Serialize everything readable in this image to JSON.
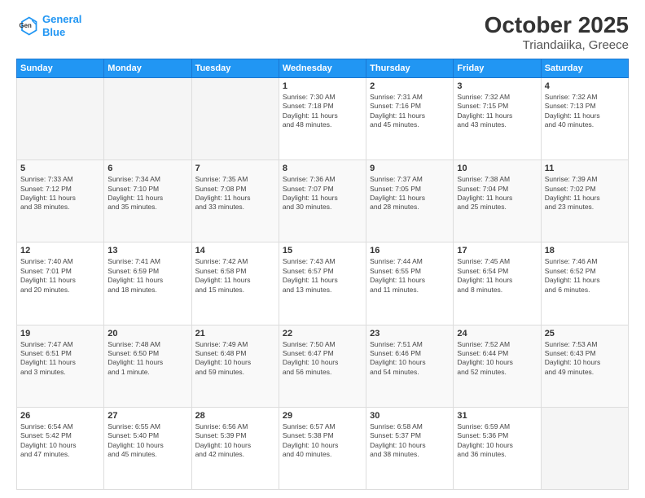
{
  "logo": {
    "line1": "General",
    "line2": "Blue"
  },
  "title": "October 2025",
  "subtitle": "Triandaiika, Greece",
  "days_of_week": [
    "Sunday",
    "Monday",
    "Tuesday",
    "Wednesday",
    "Thursday",
    "Friday",
    "Saturday"
  ],
  "weeks": [
    [
      {
        "day": "",
        "info": ""
      },
      {
        "day": "",
        "info": ""
      },
      {
        "day": "",
        "info": ""
      },
      {
        "day": "1",
        "info": "Sunrise: 7:30 AM\nSunset: 7:18 PM\nDaylight: 11 hours\nand 48 minutes."
      },
      {
        "day": "2",
        "info": "Sunrise: 7:31 AM\nSunset: 7:16 PM\nDaylight: 11 hours\nand 45 minutes."
      },
      {
        "day": "3",
        "info": "Sunrise: 7:32 AM\nSunset: 7:15 PM\nDaylight: 11 hours\nand 43 minutes."
      },
      {
        "day": "4",
        "info": "Sunrise: 7:32 AM\nSunset: 7:13 PM\nDaylight: 11 hours\nand 40 minutes."
      }
    ],
    [
      {
        "day": "5",
        "info": "Sunrise: 7:33 AM\nSunset: 7:12 PM\nDaylight: 11 hours\nand 38 minutes."
      },
      {
        "day": "6",
        "info": "Sunrise: 7:34 AM\nSunset: 7:10 PM\nDaylight: 11 hours\nand 35 minutes."
      },
      {
        "day": "7",
        "info": "Sunrise: 7:35 AM\nSunset: 7:08 PM\nDaylight: 11 hours\nand 33 minutes."
      },
      {
        "day": "8",
        "info": "Sunrise: 7:36 AM\nSunset: 7:07 PM\nDaylight: 11 hours\nand 30 minutes."
      },
      {
        "day": "9",
        "info": "Sunrise: 7:37 AM\nSunset: 7:05 PM\nDaylight: 11 hours\nand 28 minutes."
      },
      {
        "day": "10",
        "info": "Sunrise: 7:38 AM\nSunset: 7:04 PM\nDaylight: 11 hours\nand 25 minutes."
      },
      {
        "day": "11",
        "info": "Sunrise: 7:39 AM\nSunset: 7:02 PM\nDaylight: 11 hours\nand 23 minutes."
      }
    ],
    [
      {
        "day": "12",
        "info": "Sunrise: 7:40 AM\nSunset: 7:01 PM\nDaylight: 11 hours\nand 20 minutes."
      },
      {
        "day": "13",
        "info": "Sunrise: 7:41 AM\nSunset: 6:59 PM\nDaylight: 11 hours\nand 18 minutes."
      },
      {
        "day": "14",
        "info": "Sunrise: 7:42 AM\nSunset: 6:58 PM\nDaylight: 11 hours\nand 15 minutes."
      },
      {
        "day": "15",
        "info": "Sunrise: 7:43 AM\nSunset: 6:57 PM\nDaylight: 11 hours\nand 13 minutes."
      },
      {
        "day": "16",
        "info": "Sunrise: 7:44 AM\nSunset: 6:55 PM\nDaylight: 11 hours\nand 11 minutes."
      },
      {
        "day": "17",
        "info": "Sunrise: 7:45 AM\nSunset: 6:54 PM\nDaylight: 11 hours\nand 8 minutes."
      },
      {
        "day": "18",
        "info": "Sunrise: 7:46 AM\nSunset: 6:52 PM\nDaylight: 11 hours\nand 6 minutes."
      }
    ],
    [
      {
        "day": "19",
        "info": "Sunrise: 7:47 AM\nSunset: 6:51 PM\nDaylight: 11 hours\nand 3 minutes."
      },
      {
        "day": "20",
        "info": "Sunrise: 7:48 AM\nSunset: 6:50 PM\nDaylight: 11 hours\nand 1 minute."
      },
      {
        "day": "21",
        "info": "Sunrise: 7:49 AM\nSunset: 6:48 PM\nDaylight: 10 hours\nand 59 minutes."
      },
      {
        "day": "22",
        "info": "Sunrise: 7:50 AM\nSunset: 6:47 PM\nDaylight: 10 hours\nand 56 minutes."
      },
      {
        "day": "23",
        "info": "Sunrise: 7:51 AM\nSunset: 6:46 PM\nDaylight: 10 hours\nand 54 minutes."
      },
      {
        "day": "24",
        "info": "Sunrise: 7:52 AM\nSunset: 6:44 PM\nDaylight: 10 hours\nand 52 minutes."
      },
      {
        "day": "25",
        "info": "Sunrise: 7:53 AM\nSunset: 6:43 PM\nDaylight: 10 hours\nand 49 minutes."
      }
    ],
    [
      {
        "day": "26",
        "info": "Sunrise: 6:54 AM\nSunset: 5:42 PM\nDaylight: 10 hours\nand 47 minutes."
      },
      {
        "day": "27",
        "info": "Sunrise: 6:55 AM\nSunset: 5:40 PM\nDaylight: 10 hours\nand 45 minutes."
      },
      {
        "day": "28",
        "info": "Sunrise: 6:56 AM\nSunset: 5:39 PM\nDaylight: 10 hours\nand 42 minutes."
      },
      {
        "day": "29",
        "info": "Sunrise: 6:57 AM\nSunset: 5:38 PM\nDaylight: 10 hours\nand 40 minutes."
      },
      {
        "day": "30",
        "info": "Sunrise: 6:58 AM\nSunset: 5:37 PM\nDaylight: 10 hours\nand 38 minutes."
      },
      {
        "day": "31",
        "info": "Sunrise: 6:59 AM\nSunset: 5:36 PM\nDaylight: 10 hours\nand 36 minutes."
      },
      {
        "day": "",
        "info": ""
      }
    ]
  ]
}
